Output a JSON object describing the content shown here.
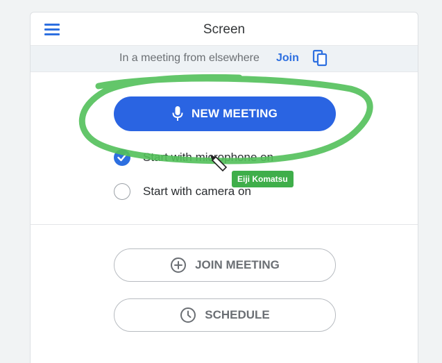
{
  "header": {
    "title": "Screen",
    "menu_icon": "hamburger-menu-icon"
  },
  "banner": {
    "text": "In a meeting from elsewhere",
    "join_label": "Join",
    "copy_icon": "copy-icon"
  },
  "new_meeting": {
    "label": "NEW MEETING",
    "icon": "microphone-icon",
    "color": "#2a64e2"
  },
  "options": {
    "microphone": {
      "label": "Start with microphone on",
      "checked": true
    },
    "camera": {
      "label": "Start with camera on",
      "checked": false
    }
  },
  "join_meeting": {
    "label": "JOIN MEETING",
    "icon": "plus-circle-icon"
  },
  "schedule": {
    "label": "SCHEDULE",
    "icon": "clock-icon"
  },
  "annotation": {
    "author": "Eiji Komatsu",
    "color": "#3fae4a",
    "cursor_icon": "pencil-cursor-icon"
  }
}
